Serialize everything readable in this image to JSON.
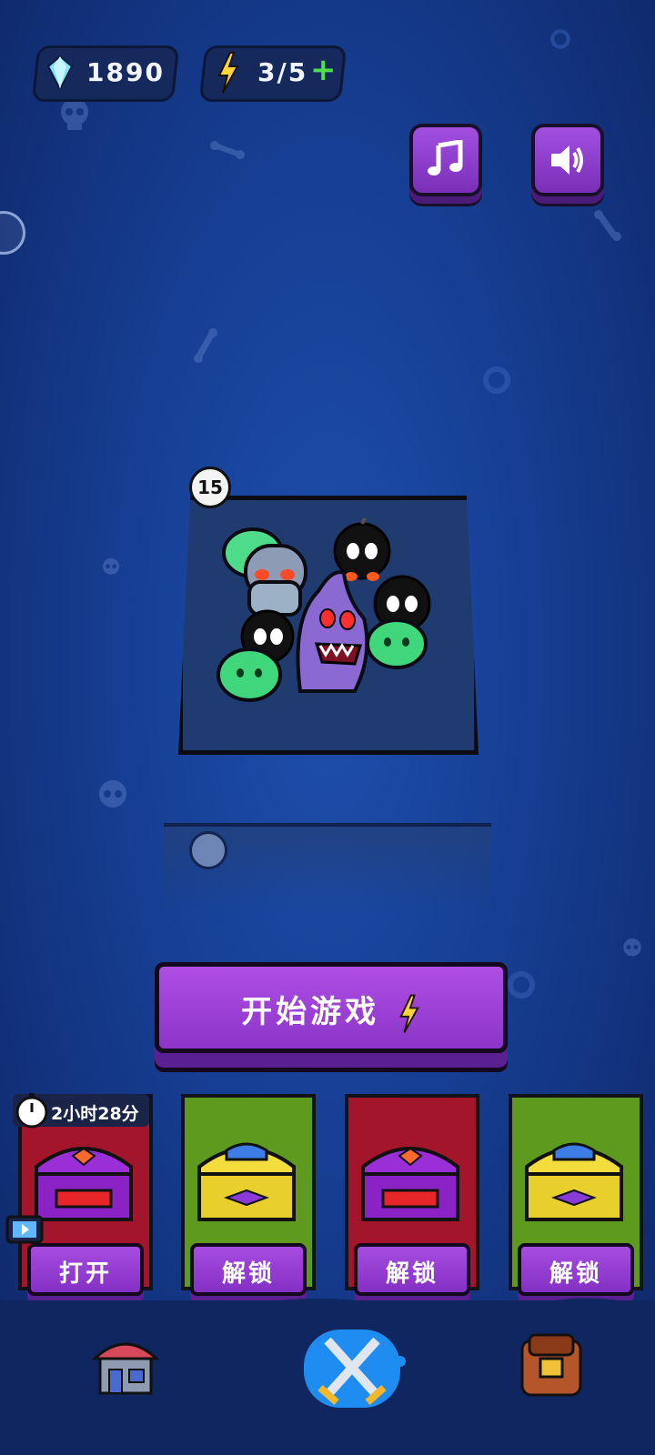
{
  "hud": {
    "gems": "1890",
    "energy": "3/5"
  },
  "settings": {
    "music_icon": "music-note-icon",
    "sound_icon": "speaker-icon"
  },
  "arena": {
    "level": "15"
  },
  "start_button": {
    "label": "开始游戏"
  },
  "chests": [
    {
      "color": "red",
      "chest": "purple-chest",
      "button": "打开",
      "timer": "2小时28分"
    },
    {
      "color": "green",
      "chest": "gold-chest",
      "button": "解锁"
    },
    {
      "color": "red",
      "chest": "purple-chest",
      "button": "解锁"
    },
    {
      "color": "green",
      "chest": "gold-chest",
      "button": "解锁"
    }
  ],
  "nav": [
    "shop-icon",
    "battle-icon",
    "backpack-icon"
  ],
  "colors": {
    "accent": "#9a41d6",
    "background": "#163e92",
    "plus": "#4ee04c"
  }
}
